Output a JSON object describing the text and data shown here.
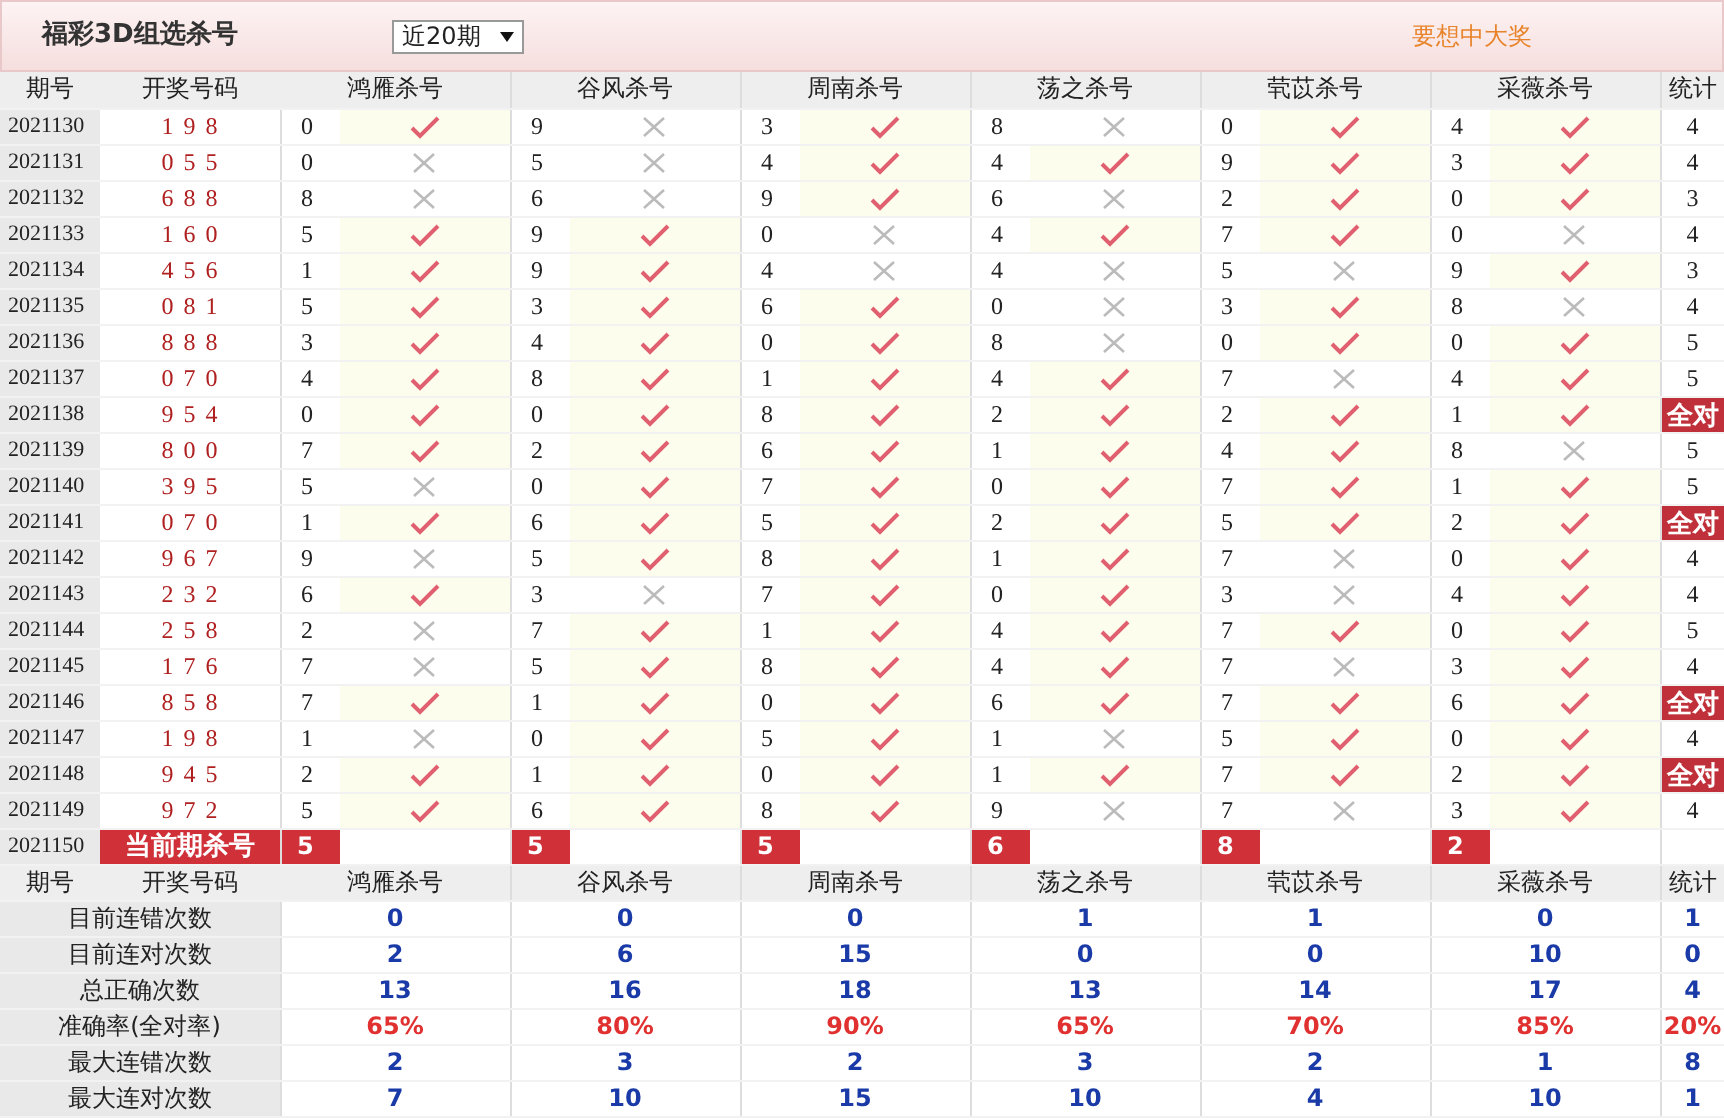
{
  "header": {
    "title": "福彩3D组选杀号",
    "period_select": {
      "value": "近20期"
    },
    "promo": "要想中大奖"
  },
  "columns": [
    "期号",
    "开奖号码",
    "鸿雁杀号",
    "谷风杀号",
    "周南杀号",
    "荡之杀号",
    "茕苡杀号",
    "采薇杀号",
    "统计"
  ],
  "rows": [
    {
      "issue": "2021130",
      "draw": "1 9 8",
      "kills": [
        {
          "num": "0",
          "correct": true
        },
        {
          "num": "9",
          "correct": false
        },
        {
          "num": "3",
          "correct": true
        },
        {
          "num": "8",
          "correct": false
        },
        {
          "num": "0",
          "correct": true
        },
        {
          "num": "4",
          "correct": true
        }
      ],
      "stat": {
        "kind": "count",
        "text": "4"
      }
    },
    {
      "issue": "2021131",
      "draw": "0 5 5",
      "kills": [
        {
          "num": "0",
          "correct": false
        },
        {
          "num": "5",
          "correct": false
        },
        {
          "num": "4",
          "correct": true
        },
        {
          "num": "4",
          "correct": true
        },
        {
          "num": "9",
          "correct": true
        },
        {
          "num": "3",
          "correct": true
        }
      ],
      "stat": {
        "kind": "count",
        "text": "4"
      }
    },
    {
      "issue": "2021132",
      "draw": "6 8 8",
      "kills": [
        {
          "num": "8",
          "correct": false
        },
        {
          "num": "6",
          "correct": false
        },
        {
          "num": "9",
          "correct": true
        },
        {
          "num": "6",
          "correct": false
        },
        {
          "num": "2",
          "correct": true
        },
        {
          "num": "0",
          "correct": true
        }
      ],
      "stat": {
        "kind": "count",
        "text": "3"
      }
    },
    {
      "issue": "2021133",
      "draw": "1 6 0",
      "kills": [
        {
          "num": "5",
          "correct": true
        },
        {
          "num": "9",
          "correct": true
        },
        {
          "num": "0",
          "correct": false
        },
        {
          "num": "4",
          "correct": true
        },
        {
          "num": "7",
          "correct": true
        },
        {
          "num": "0",
          "correct": false
        }
      ],
      "stat": {
        "kind": "count",
        "text": "4"
      }
    },
    {
      "issue": "2021134",
      "draw": "4 5 6",
      "kills": [
        {
          "num": "1",
          "correct": true
        },
        {
          "num": "9",
          "correct": true
        },
        {
          "num": "4",
          "correct": false
        },
        {
          "num": "4",
          "correct": false
        },
        {
          "num": "5",
          "correct": false
        },
        {
          "num": "9",
          "correct": true
        }
      ],
      "stat": {
        "kind": "count",
        "text": "3"
      }
    },
    {
      "issue": "2021135",
      "draw": "0 8 1",
      "kills": [
        {
          "num": "5",
          "correct": true
        },
        {
          "num": "3",
          "correct": true
        },
        {
          "num": "6",
          "correct": true
        },
        {
          "num": "0",
          "correct": false
        },
        {
          "num": "3",
          "correct": true
        },
        {
          "num": "8",
          "correct": false
        }
      ],
      "stat": {
        "kind": "count",
        "text": "4"
      }
    },
    {
      "issue": "2021136",
      "draw": "8 8 8",
      "kills": [
        {
          "num": "3",
          "correct": true
        },
        {
          "num": "4",
          "correct": true
        },
        {
          "num": "0",
          "correct": true
        },
        {
          "num": "8",
          "correct": false
        },
        {
          "num": "0",
          "correct": true
        },
        {
          "num": "0",
          "correct": true
        }
      ],
      "stat": {
        "kind": "count",
        "text": "5"
      }
    },
    {
      "issue": "2021137",
      "draw": "0 7 0",
      "kills": [
        {
          "num": "4",
          "correct": true
        },
        {
          "num": "8",
          "correct": true
        },
        {
          "num": "1",
          "correct": true
        },
        {
          "num": "4",
          "correct": true
        },
        {
          "num": "7",
          "correct": false
        },
        {
          "num": "4",
          "correct": true
        }
      ],
      "stat": {
        "kind": "count",
        "text": "5"
      }
    },
    {
      "issue": "2021138",
      "draw": "9 5 4",
      "kills": [
        {
          "num": "0",
          "correct": true
        },
        {
          "num": "0",
          "correct": true
        },
        {
          "num": "8",
          "correct": true
        },
        {
          "num": "2",
          "correct": true
        },
        {
          "num": "2",
          "correct": true
        },
        {
          "num": "1",
          "correct": true
        }
      ],
      "stat": {
        "kind": "all_correct",
        "text": "全对"
      }
    },
    {
      "issue": "2021139",
      "draw": "8 0 0",
      "kills": [
        {
          "num": "7",
          "correct": true
        },
        {
          "num": "2",
          "correct": true
        },
        {
          "num": "6",
          "correct": true
        },
        {
          "num": "1",
          "correct": true
        },
        {
          "num": "4",
          "correct": true
        },
        {
          "num": "8",
          "correct": false
        }
      ],
      "stat": {
        "kind": "count",
        "text": "5"
      }
    },
    {
      "issue": "2021140",
      "draw": "3 9 5",
      "kills": [
        {
          "num": "5",
          "correct": false
        },
        {
          "num": "0",
          "correct": true
        },
        {
          "num": "7",
          "correct": true
        },
        {
          "num": "0",
          "correct": true
        },
        {
          "num": "7",
          "correct": true
        },
        {
          "num": "1",
          "correct": true
        }
      ],
      "stat": {
        "kind": "count",
        "text": "5"
      }
    },
    {
      "issue": "2021141",
      "draw": "0 7 0",
      "kills": [
        {
          "num": "1",
          "correct": true
        },
        {
          "num": "6",
          "correct": true
        },
        {
          "num": "5",
          "correct": true
        },
        {
          "num": "2",
          "correct": true
        },
        {
          "num": "5",
          "correct": true
        },
        {
          "num": "2",
          "correct": true
        }
      ],
      "stat": {
        "kind": "all_correct",
        "text": "全对"
      }
    },
    {
      "issue": "2021142",
      "draw": "9 6 7",
      "kills": [
        {
          "num": "9",
          "correct": false
        },
        {
          "num": "5",
          "correct": true
        },
        {
          "num": "8",
          "correct": true
        },
        {
          "num": "1",
          "correct": true
        },
        {
          "num": "7",
          "correct": false
        },
        {
          "num": "0",
          "correct": true
        }
      ],
      "stat": {
        "kind": "count",
        "text": "4"
      }
    },
    {
      "issue": "2021143",
      "draw": "2 3 2",
      "kills": [
        {
          "num": "6",
          "correct": true
        },
        {
          "num": "3",
          "correct": false
        },
        {
          "num": "7",
          "correct": true
        },
        {
          "num": "0",
          "correct": true
        },
        {
          "num": "3",
          "correct": false
        },
        {
          "num": "4",
          "correct": true
        }
      ],
      "stat": {
        "kind": "count",
        "text": "4"
      }
    },
    {
      "issue": "2021144",
      "draw": "2 5 8",
      "kills": [
        {
          "num": "2",
          "correct": false
        },
        {
          "num": "7",
          "correct": true
        },
        {
          "num": "1",
          "correct": true
        },
        {
          "num": "4",
          "correct": true
        },
        {
          "num": "7",
          "correct": true
        },
        {
          "num": "0",
          "correct": true
        }
      ],
      "stat": {
        "kind": "count",
        "text": "5"
      }
    },
    {
      "issue": "2021145",
      "draw": "1 7 6",
      "kills": [
        {
          "num": "7",
          "correct": false
        },
        {
          "num": "5",
          "correct": true
        },
        {
          "num": "8",
          "correct": true
        },
        {
          "num": "4",
          "correct": true
        },
        {
          "num": "7",
          "correct": false
        },
        {
          "num": "3",
          "correct": true
        }
      ],
      "stat": {
        "kind": "count",
        "text": "4"
      }
    },
    {
      "issue": "2021146",
      "draw": "8 5 8",
      "kills": [
        {
          "num": "7",
          "correct": true
        },
        {
          "num": "1",
          "correct": true
        },
        {
          "num": "0",
          "correct": true
        },
        {
          "num": "6",
          "correct": true
        },
        {
          "num": "7",
          "correct": true
        },
        {
          "num": "6",
          "correct": true
        }
      ],
      "stat": {
        "kind": "all_correct",
        "text": "全对"
      }
    },
    {
      "issue": "2021147",
      "draw": "1 9 8",
      "kills": [
        {
          "num": "1",
          "correct": false
        },
        {
          "num": "0",
          "correct": true
        },
        {
          "num": "5",
          "correct": true
        },
        {
          "num": "1",
          "correct": false
        },
        {
          "num": "5",
          "correct": true
        },
        {
          "num": "0",
          "correct": true
        }
      ],
      "stat": {
        "kind": "count",
        "text": "4"
      }
    },
    {
      "issue": "2021148",
      "draw": "9 4 5",
      "kills": [
        {
          "num": "2",
          "correct": true
        },
        {
          "num": "1",
          "correct": true
        },
        {
          "num": "0",
          "correct": true
        },
        {
          "num": "1",
          "correct": true
        },
        {
          "num": "7",
          "correct": true
        },
        {
          "num": "2",
          "correct": true
        }
      ],
      "stat": {
        "kind": "all_correct",
        "text": "全对"
      }
    },
    {
      "issue": "2021149",
      "draw": "9 7 2",
      "kills": [
        {
          "num": "5",
          "correct": true
        },
        {
          "num": "6",
          "correct": true
        },
        {
          "num": "8",
          "correct": true
        },
        {
          "num": "9",
          "correct": false
        },
        {
          "num": "7",
          "correct": false
        },
        {
          "num": "3",
          "correct": true
        }
      ],
      "stat": {
        "kind": "count",
        "text": "4"
      }
    }
  ],
  "current": {
    "issue": "2021150",
    "label": "当前期杀号",
    "kills": [
      "5",
      "5",
      "5",
      "6",
      "8",
      "2"
    ]
  },
  "summary_columns": [
    "期号",
    "开奖号码",
    "鸿雁杀号",
    "谷风杀号",
    "周南杀号",
    "荡之杀号",
    "茕苡杀号",
    "采薇杀号",
    "统计"
  ],
  "summary": [
    {
      "label": "目前连错次数",
      "kind": "count",
      "values": [
        "0",
        "0",
        "0",
        "1",
        "1",
        "0"
      ],
      "stat": "1"
    },
    {
      "label": "目前连对次数",
      "kind": "count",
      "values": [
        "2",
        "6",
        "15",
        "0",
        "0",
        "10"
      ],
      "stat": "0"
    },
    {
      "label": "总正确次数",
      "kind": "count",
      "values": [
        "13",
        "16",
        "18",
        "13",
        "14",
        "17"
      ],
      "stat": "4"
    },
    {
      "label": "准确率(全对率)",
      "kind": "rate",
      "values": [
        "65%",
        "80%",
        "90%",
        "65%",
        "70%",
        "85%"
      ],
      "stat": "20%"
    },
    {
      "label": "最大连错次数",
      "kind": "count",
      "values": [
        "2",
        "3",
        "2",
        "3",
        "2",
        "1"
      ],
      "stat": "8"
    },
    {
      "label": "最大连对次数",
      "kind": "count",
      "values": [
        "7",
        "10",
        "15",
        "10",
        "4",
        "10"
      ],
      "stat": "1"
    }
  ]
}
